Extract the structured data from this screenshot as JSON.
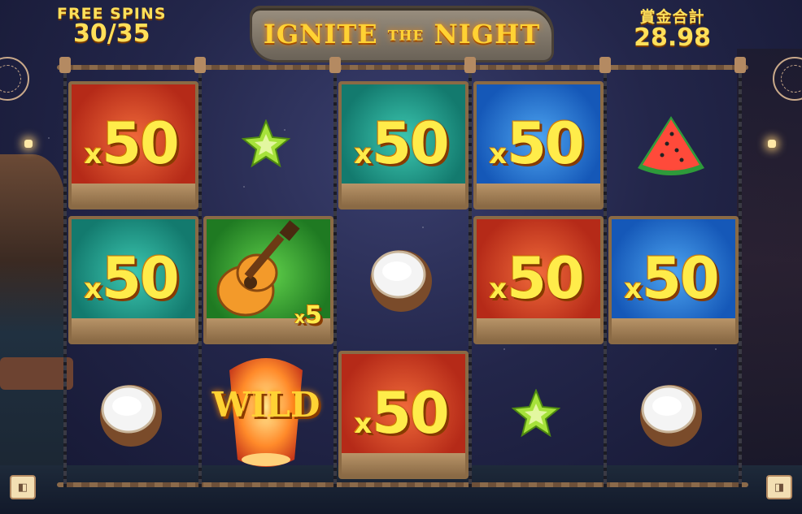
{
  "game": {
    "title_main1": "IGNITE",
    "title_small": "THE",
    "title_main2": "NIGHT"
  },
  "hud": {
    "free_spins_label": "FREE SPINS",
    "free_spins_value": "30/35",
    "total_win_label": "賞金合計",
    "total_win_value": "28.98"
  },
  "reels": {
    "columns": 5,
    "rows": 3,
    "symbols": [
      {
        "col": 0,
        "row": 0,
        "type": "multiplier-tile",
        "color": "red",
        "prefix": "x",
        "value": "50"
      },
      {
        "col": 1,
        "row": 0,
        "type": "starfruit"
      },
      {
        "col": 2,
        "row": 0,
        "type": "multiplier-tile",
        "color": "teal",
        "prefix": "x",
        "value": "50"
      },
      {
        "col": 3,
        "row": 0,
        "type": "multiplier-tile",
        "color": "blue",
        "prefix": "x",
        "value": "50"
      },
      {
        "col": 4,
        "row": 0,
        "type": "watermelon"
      },
      {
        "col": 0,
        "row": 1,
        "type": "multiplier-tile",
        "color": "teal",
        "prefix": "x",
        "value": "50"
      },
      {
        "col": 1,
        "row": 1,
        "type": "guitar-tile",
        "color": "green",
        "prefix": "x",
        "value": "5"
      },
      {
        "col": 2,
        "row": 1,
        "type": "coconut"
      },
      {
        "col": 3,
        "row": 1,
        "type": "multiplier-tile",
        "color": "red",
        "prefix": "x",
        "value": "50"
      },
      {
        "col": 4,
        "row": 1,
        "type": "multiplier-tile",
        "color": "blue",
        "prefix": "x",
        "value": "50"
      },
      {
        "col": 0,
        "row": 2,
        "type": "coconut"
      },
      {
        "col": 1,
        "row": 2,
        "type": "wild-lantern",
        "label": "WILD"
      },
      {
        "col": 2,
        "row": 2,
        "type": "multiplier-tile",
        "color": "red",
        "prefix": "x",
        "value": "50"
      },
      {
        "col": 3,
        "row": 2,
        "type": "starfruit"
      },
      {
        "col": 4,
        "row": 2,
        "type": "coconut"
      }
    ]
  },
  "colors": {
    "gold": "#ffe05a",
    "red_tile": "#b52a18",
    "teal_tile": "#137a6e",
    "blue_tile": "#1558b8",
    "green_tile": "#1f7a22"
  }
}
